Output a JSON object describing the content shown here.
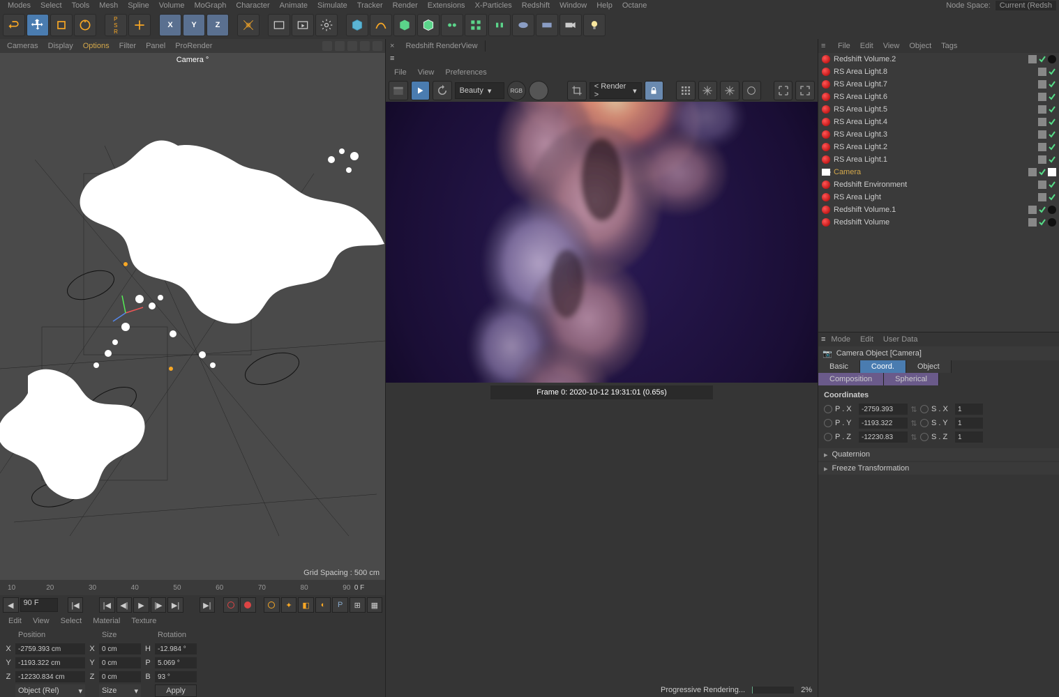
{
  "menu": {
    "items": [
      "Modes",
      "Select",
      "Tools",
      "Mesh",
      "Spline",
      "Volume",
      "MoGraph",
      "Character",
      "Animate",
      "Simulate",
      "Tracker",
      "Render",
      "Extensions",
      "X-Particles",
      "Redshift",
      "Window",
      "Help",
      "Octane"
    ],
    "node_space_label": "Node Space:",
    "node_space_value": "Current (Redsh"
  },
  "viewport": {
    "menu": [
      "Cameras",
      "Display",
      "Options",
      "Filter",
      "Panel",
      "ProRender"
    ],
    "camera_label": "Camera °",
    "grid_spacing": "Grid Spacing : 500 cm"
  },
  "timeline": {
    "ticks": [
      "10",
      "20",
      "30",
      "40",
      "50",
      "60",
      "70",
      "80",
      "90"
    ],
    "end_tick": "0 F",
    "frame_field": "90 F"
  },
  "lower_menu": [
    "Edit",
    "View",
    "Select",
    "Material",
    "Texture"
  ],
  "coords": {
    "pos_hdr": "Position",
    "size_hdr": "Size",
    "rot_hdr": "Rotation",
    "x": "X",
    "y": "Y",
    "z": "Z",
    "px": "-2759.393 cm",
    "py": "-1193.322 cm",
    "pz": "-12230.834 cm",
    "sx": "0 cm",
    "sy": "0 cm",
    "sz": "0 cm",
    "h": "H",
    "p": "P",
    "b": "B",
    "rh": "-12.984 °",
    "rp": "5.069 °",
    "rb": "93 °",
    "mode1": "Object (Rel)",
    "mode2": "Size",
    "apply": "Apply"
  },
  "renderview": {
    "tab": "Redshift RenderView",
    "menu": [
      "File",
      "View",
      "Preferences"
    ],
    "aov": "Beauty",
    "render_dd": "< Render >",
    "rgb": "RGB",
    "frame_info": "Frame  0:  2020-10-12  19:31:01  (0.65s)"
  },
  "status": {
    "text": "Progressive Rendering...",
    "pct": "2%"
  },
  "objects": {
    "menu": [
      "File",
      "Edit",
      "View",
      "Object",
      "Tags"
    ],
    "items": [
      {
        "name": "Redshift Volume.2",
        "icon": "red",
        "swatch": true
      },
      {
        "name": "RS Area Light.8",
        "icon": "red"
      },
      {
        "name": "RS Area Light.7",
        "icon": "red"
      },
      {
        "name": "RS Area Light.6",
        "icon": "red"
      },
      {
        "name": "RS Area Light.5",
        "icon": "red"
      },
      {
        "name": "RS Area Light.4",
        "icon": "red"
      },
      {
        "name": "RS Area Light.3",
        "icon": "red"
      },
      {
        "name": "RS Area Light.2",
        "icon": "red"
      },
      {
        "name": "RS Area Light.1",
        "icon": "red"
      },
      {
        "name": "Camera",
        "icon": "cam",
        "selected": true,
        "cam_tag": true
      },
      {
        "name": "Redshift Environment",
        "icon": "red"
      },
      {
        "name": "RS Area Light",
        "icon": "red"
      },
      {
        "name": "Redshift Volume.1",
        "icon": "red",
        "swatch": true
      },
      {
        "name": "Redshift Volume",
        "icon": "red",
        "swatch": true
      }
    ]
  },
  "attr": {
    "menu": [
      "Mode",
      "Edit",
      "User Data"
    ],
    "title": "Camera Object [Camera]",
    "tabs": [
      "Basic",
      "Coord.",
      "Object"
    ],
    "tabs2": [
      "Composition",
      "Spherical"
    ],
    "section": "Coordinates",
    "px_lbl": "P . X",
    "py_lbl": "P . Y",
    "pz_lbl": "P . Z",
    "sx_lbl": "S . X",
    "sy_lbl": "S . Y",
    "sz_lbl": "S . Z",
    "px": "-2759.393",
    "py": "-1193.322",
    "pz": "-12230.83",
    "sx": "1",
    "sy": "1",
    "sz": "1",
    "quaternion": "Quaternion",
    "freeze": "Freeze Transformation"
  }
}
